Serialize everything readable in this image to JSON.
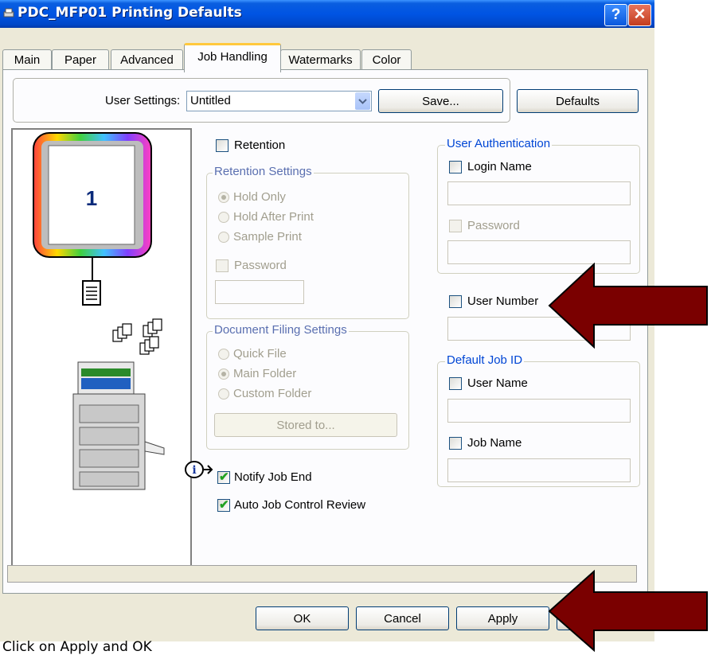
{
  "window": {
    "title": "PDC_MFP01 Printing Defaults",
    "help_label": "?",
    "close_label": "✕"
  },
  "tabs": [
    {
      "label": "Main"
    },
    {
      "label": "Paper"
    },
    {
      "label": "Advanced"
    },
    {
      "label": "Job Handling",
      "active": true
    },
    {
      "label": "Watermarks"
    },
    {
      "label": "Color"
    }
  ],
  "user_settings": {
    "label": "User Settings:",
    "value": "Untitled",
    "save_label": "Save...",
    "defaults_label": "Defaults"
  },
  "preview": {
    "page_number": "1"
  },
  "retention": {
    "checkbox_label": "Retention",
    "group_label": "Retention Settings",
    "options": [
      "Hold Only",
      "Hold After Print",
      "Sample Print"
    ],
    "selected": "Hold Only",
    "password_label": "Password"
  },
  "document_filing": {
    "group_label": "Document Filing Settings",
    "options": [
      "Quick File",
      "Main Folder",
      "Custom Folder"
    ],
    "selected": "Main Folder",
    "stored_to_label": "Stored to..."
  },
  "notify_job_end_label": "Notify Job End",
  "auto_job_control_label": "Auto Job Control Review",
  "user_authentication": {
    "group_label": "User Authentication",
    "login_name_label": "Login Name",
    "password_label": "Password"
  },
  "user_number_label": "User Number",
  "default_job_id": {
    "group_label": "Default Job ID",
    "user_name_label": "User Name",
    "job_name_label": "Job Name"
  },
  "buttons": {
    "ok": "OK",
    "cancel": "Cancel",
    "apply": "Apply"
  },
  "caption": "Click on Apply and OK",
  "colors": {
    "arrow": "#7a0000",
    "title_bar": "#0054e3",
    "legend_blue": "#0046d5"
  }
}
